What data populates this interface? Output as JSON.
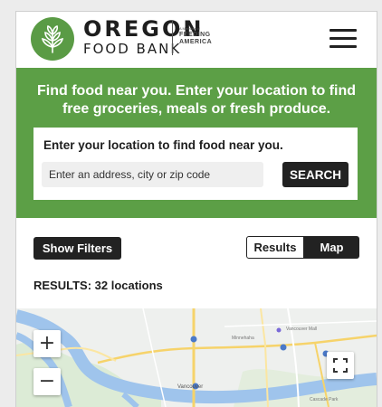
{
  "header": {
    "brand_top": "OREGON",
    "brand_bottom": "FOOD BANK",
    "partner_prefix": "A Member of",
    "partner_line1": "FEEDING",
    "partner_line2": "AMERICA",
    "menu_icon": "hamburger-menu-icon",
    "logo_icon": "wheat-sprout-logo-icon"
  },
  "banner": {
    "headline": "Find food near you. Enter your location to find free groceries, meals or fresh produce."
  },
  "search": {
    "title": "Enter your location to find food near you.",
    "placeholder": "Enter an address, city or zip code",
    "value": "",
    "button_label": "SEARCH"
  },
  "controls": {
    "filters_label": "Show Filters",
    "view_toggle": [
      "Results",
      "Map"
    ],
    "active_view": "Map"
  },
  "results": {
    "summary": "RESULTS: 32 locations"
  },
  "map": {
    "zoom_in": "+",
    "zoom_out": "−",
    "fullscreen_icon": "fullscreen-icon",
    "labels": [
      "Vancouver Mall",
      "Minnehaha",
      "Vancouver",
      "Cascade Park"
    ]
  },
  "colors": {
    "brand_green": "#5c9f46",
    "dark_button": "#222222",
    "map_water": "#9fc4ec",
    "map_road_yellow": "#f6d36a"
  }
}
